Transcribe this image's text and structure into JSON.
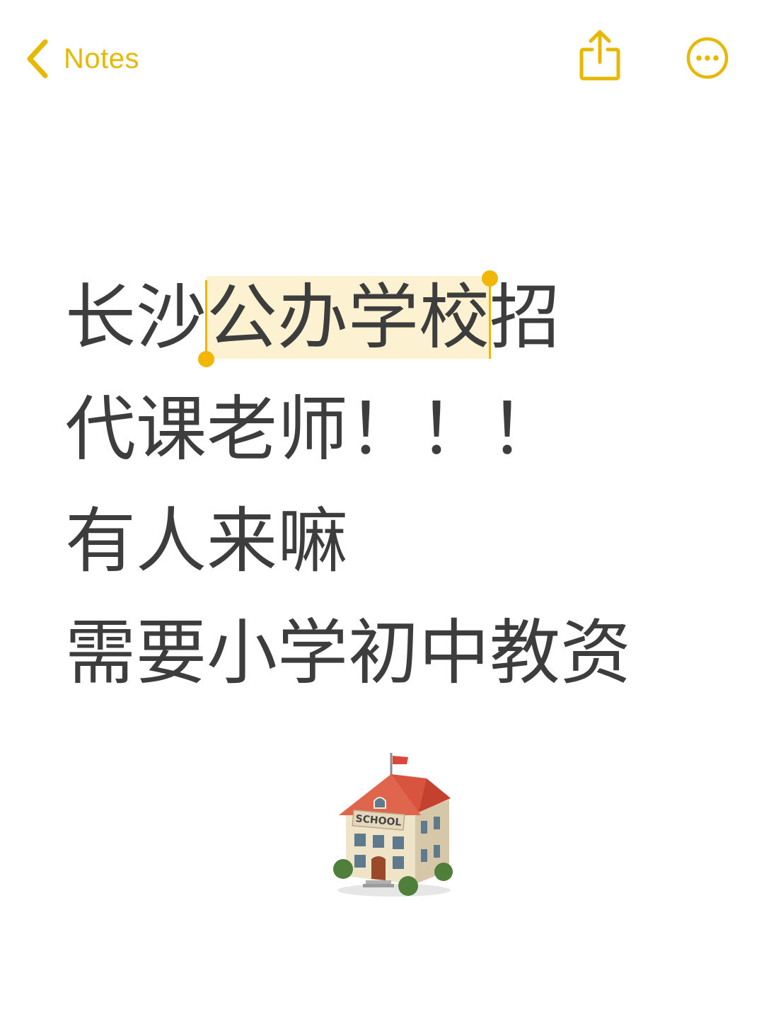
{
  "nav": {
    "back_label": "Notes",
    "back_icon": "chevron-left-icon",
    "share_icon": "share-icon",
    "more_icon": "more-ellipsis-icon",
    "accent_color": "#E6B800"
  },
  "note": {
    "line1_before": "长沙",
    "line1_selected": "公办学校",
    "line1_after": "招",
    "line2": "代课老师！！！",
    "line3": "有人来嘛",
    "line4": "需要小学初中教资",
    "selection_color": "#FCF2D2",
    "text_color": "#3d3d3d"
  },
  "emoji": {
    "name": "school-building-icon",
    "sign_text": "SCHOOL"
  }
}
